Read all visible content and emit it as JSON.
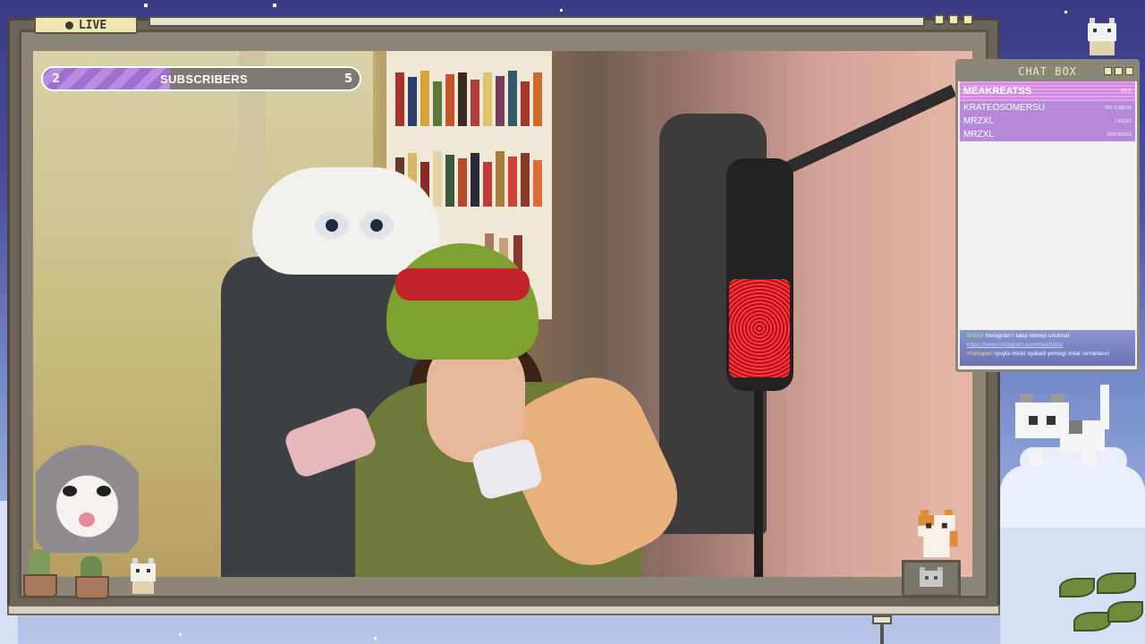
{
  "window": {
    "live_label": "LIVE"
  },
  "subscribers": {
    "current": "2",
    "label": "SUBSCRIBERS",
    "goal": "5",
    "progress_fraction": 0.4
  },
  "chat_box": {
    "title": "CHAT BOX",
    "leaderboard": [
      {
        "name": "MEAKREATSS",
        "amount": "KICK"
      },
      {
        "name": "KRATEOSOMERSU",
        "amount": "TRY 2,000.00"
      },
      {
        "name": "MRZXL",
        "amount": "1 KICKS"
      },
      {
        "name": "MRZXL",
        "amount": "1000 KICKS"
      }
    ],
    "messages": [
      {
        "user": "Botrix",
        "text": "Instagram'ı takip etmeyi unutma!"
      },
      {
        "user": "",
        "link": "https://www.instagram.com/meshlala/"
      },
      {
        "user": "r0smapen",
        "text": "ryuyla miraz oyaladi yemegi onlar ısmarlasın"
      }
    ]
  },
  "colors": {
    "frame": "#6b6559",
    "frame_light": "#8c8678",
    "pill": "#f1e7b2",
    "sub_fill": "#b78ee0",
    "chat_top": "#e5a2ea",
    "chat_row": "#b78ad9"
  },
  "icons": {
    "live": "dot-icon",
    "window_buttons": [
      "square-icon",
      "square-icon",
      "square-icon"
    ],
    "chat_buttons": [
      "square-icon",
      "square-icon",
      "square-icon"
    ]
  }
}
